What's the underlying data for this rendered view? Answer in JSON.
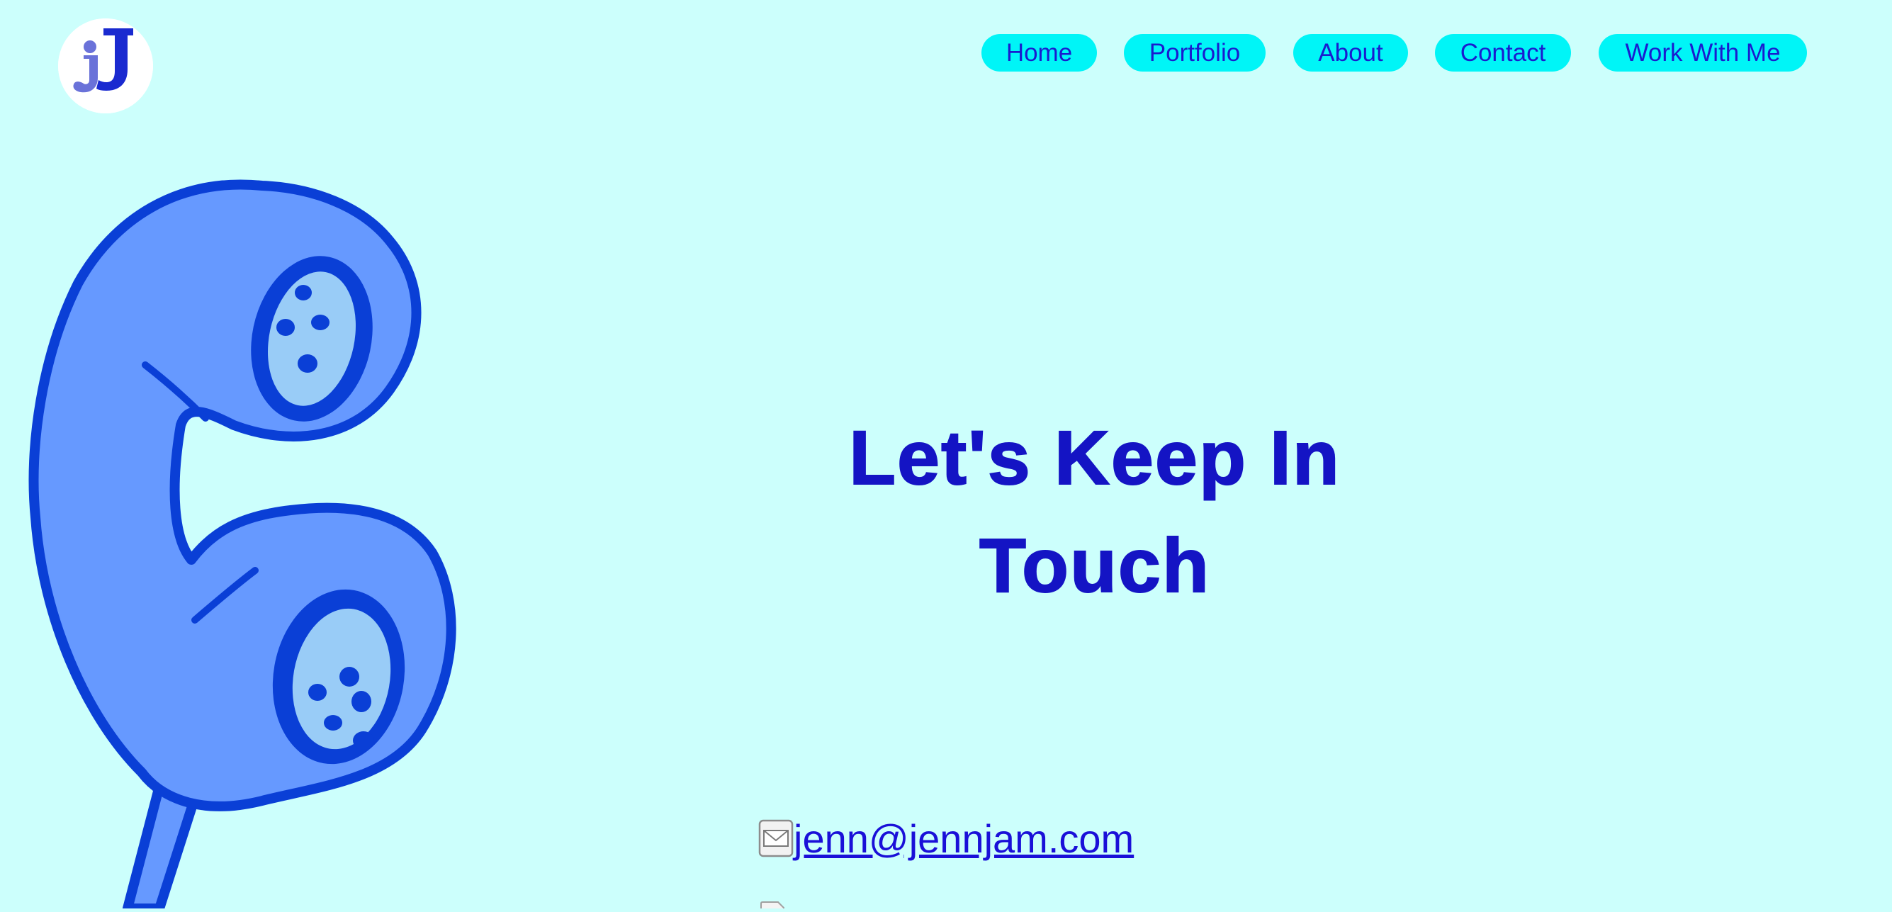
{
  "brand": {
    "logo_text": "jJ",
    "colors": {
      "page_background": "#ccfffc",
      "nav_pill": "#00f5f7",
      "nav_text": "#1a1ccf",
      "headline": "#1414c4",
      "phone_fill": "#6699ff",
      "phone_outline": "#0a3fd6",
      "earpiece_fill": "#99ccf7"
    }
  },
  "nav": {
    "items": [
      {
        "label": "Home"
      },
      {
        "label": "Portfolio"
      },
      {
        "label": "About"
      },
      {
        "label": "Contact"
      },
      {
        "label": "Work With Me"
      }
    ]
  },
  "hero": {
    "illustration_icon": "telephone-handset-icon",
    "headline_line1": "Let's Keep In",
    "headline_line2": "Touch"
  },
  "contact": {
    "email_icon": "envelope-icon",
    "email": "jenn@jennjam.com",
    "next_icon": "document-icon"
  }
}
